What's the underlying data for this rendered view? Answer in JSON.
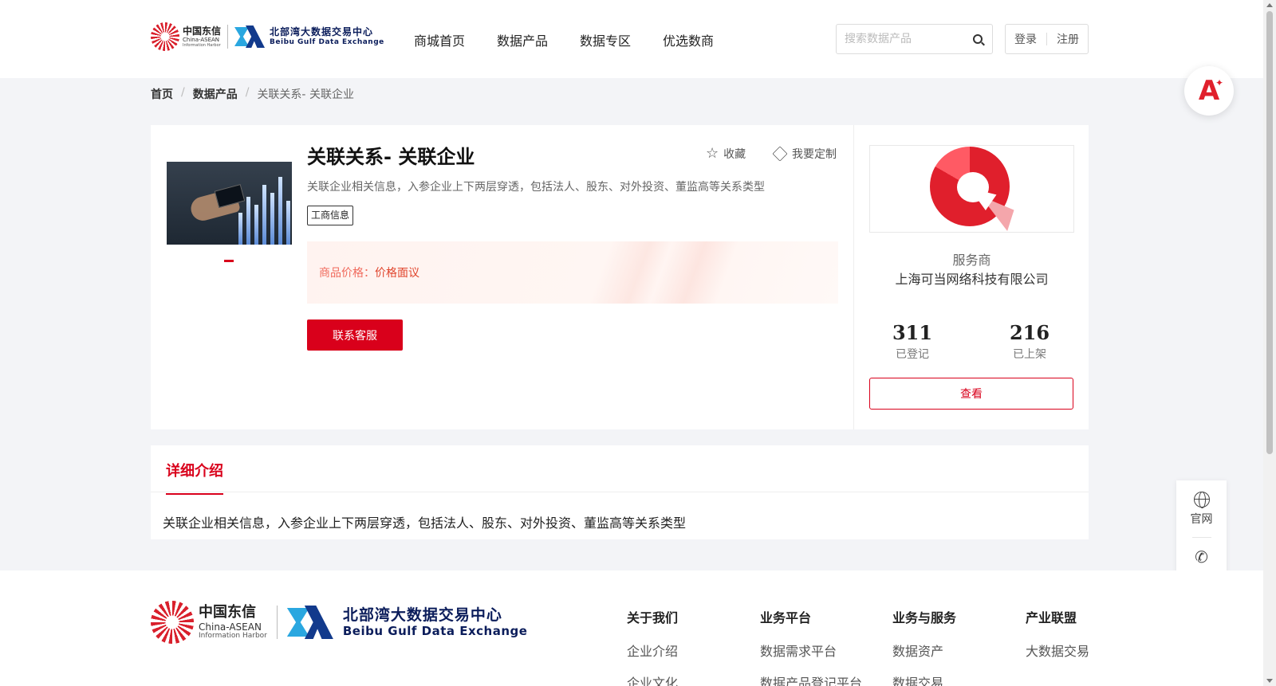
{
  "header": {
    "logo_cn": "中国东信",
    "logo_cn_en1": "China-ASEAN",
    "logo_cn_en2": "Information Harbor",
    "logo_bg_cn": "北部湾大数据交易中心",
    "logo_bg_en": "Beibu Gulf Data Exchange",
    "nav": [
      "商城首页",
      "数据产品",
      "数据专区",
      "优选数商"
    ],
    "search_placeholder": "搜索数据产品",
    "login": "登录",
    "register": "注册"
  },
  "breadcrumb": {
    "home": "首页",
    "category": "数据产品",
    "current": "关联关系- 关联企业"
  },
  "product": {
    "title": "关联关系- 关联企业",
    "favorite": "收藏",
    "customize": "我要定制",
    "description": "关联企业相关信息，入参企业上下两层穿透，包括法人、股东、对外投资、董监高等关系类型",
    "tag": "工商信息",
    "price_label": "商品价格：",
    "price_value": "价格面议",
    "contact_button": "联系客服"
  },
  "provider": {
    "label": "服务商",
    "name": "上海可当网络科技有限公司",
    "registered_count": "311",
    "registered_label": "已登记",
    "listed_count": "216",
    "listed_label": "已上架",
    "view_button": "查看"
  },
  "detail": {
    "tab": "详细介绍",
    "content": "关联企业相关信息，入参企业上下两层穿透，包括法人、股东、对外投资、董监高等关系类型"
  },
  "float": {
    "website": "官网",
    "contact": "联系"
  },
  "footer": {
    "columns": [
      {
        "heading": "关于我们",
        "link": "企业介绍",
        "link2": "企业文化"
      },
      {
        "heading": "业务平台",
        "link": "数据需求平台",
        "link2": "数据产品登记平台"
      },
      {
        "heading": "业务与服务",
        "link": "数据资产",
        "link2": "数据交易"
      },
      {
        "heading": "产业联盟",
        "link": "大数据交易"
      }
    ]
  },
  "colors": {
    "brand_red": "#d9001b",
    "navy": "#0b1d5b",
    "sky": "#2aa7e0"
  }
}
